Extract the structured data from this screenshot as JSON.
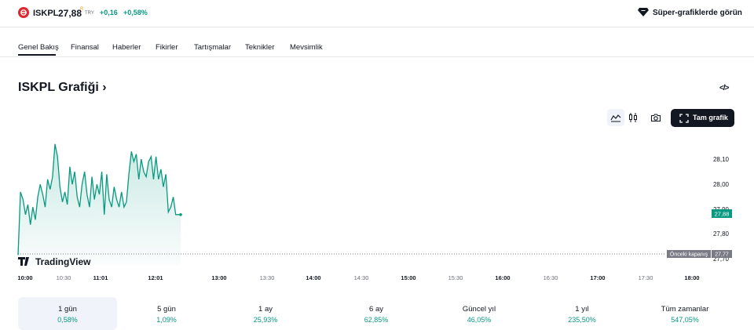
{
  "header": {
    "symbol": "ISKPL",
    "price": "27,88",
    "currency_mark": "R",
    "currency": "TRY",
    "change": "+0,16",
    "change_percent": "+0,58%",
    "super_charts_label": "Süper-grafiklerde görün",
    "colors": {
      "up": "#089981",
      "logo": "#e0262d"
    }
  },
  "tabs": [
    {
      "label": "Genel Bakış",
      "active": true
    },
    {
      "label": "Finansal"
    },
    {
      "label": "Haberler"
    },
    {
      "label": "Fikirler"
    },
    {
      "label": "Tartışmalar"
    },
    {
      "label": "Teknikler"
    },
    {
      "label": "Mevsimlik"
    }
  ],
  "chart_section": {
    "title": "ISKPL Grafiği",
    "title_arrow": "›",
    "embed_icon": "</>",
    "full_chart_label": "Tam grafik",
    "watermark": "TradingView",
    "tools": [
      "line-chart-icon",
      "candles-icon",
      "camera-icon",
      "fullscreen-icon"
    ]
  },
  "chart_data": {
    "type": "area",
    "x_ticks": [
      "10:00",
      "10:30",
      "11:01",
      "12:01",
      "13:00",
      "13:30",
      "14:00",
      "14:30",
      "15:00",
      "15:30",
      "16:00",
      "16:30",
      "17:00",
      "17:30",
      "18:00"
    ],
    "bold_x_ticks": [
      "10:00",
      "11:01",
      "12:01",
      "13:00",
      "14:00",
      "15:00",
      "16:00",
      "17:00",
      "18:00"
    ],
    "y_ticks": [
      "28,10",
      "28,00",
      "27,90",
      "27,80",
      "27,70"
    ],
    "ylim": [
      27.68,
      28.18
    ],
    "x_range_minutes": [
      0,
      480
    ],
    "current_price": "27,88",
    "previous_close_label": "Önceki kapanış",
    "previous_close": "27,77",
    "colors": {
      "line": "#089981",
      "fill": "#089981",
      "prev_close": "#787b86"
    },
    "series": [
      {
        "values": [
          27.72,
          27.97,
          27.94,
          27.88,
          27.92,
          27.84,
          27.91,
          27.86,
          27.95,
          28.0,
          27.96,
          27.91,
          28.02,
          27.98,
          28.03,
          28.16,
          28.11,
          27.99,
          27.93,
          27.97,
          27.92,
          28.07,
          28.0,
          28.05,
          27.95,
          27.91,
          28.0,
          28.05,
          27.96,
          27.91,
          28.03,
          27.94,
          28.0,
          27.96,
          28.05,
          27.88,
          28.04,
          27.94,
          27.91,
          27.99,
          27.94,
          27.91,
          27.97,
          27.91,
          27.93,
          28.04,
          28.13,
          28.09,
          28.12,
          28.02,
          28.1,
          28.05,
          28.03,
          28.09,
          28.11,
          28.02,
          28.11,
          28.02,
          28.06,
          27.99,
          28.04,
          27.89,
          27.91,
          27.95,
          27.88,
          27.88,
          27.88
        ]
      }
    ]
  },
  "ranges": [
    {
      "label": "1 gün",
      "value": "0,58%",
      "selected": true
    },
    {
      "label": "5 gün",
      "value": "1,09%"
    },
    {
      "label": "1 ay",
      "value": "25,93%"
    },
    {
      "label": "6 ay",
      "value": "62,85%"
    },
    {
      "label": "Güncel yıl",
      "value": "46,05%"
    },
    {
      "label": "1 yıl",
      "value": "235,50%"
    },
    {
      "label": "Tüm zamanlar",
      "value": "547,05%"
    }
  ]
}
